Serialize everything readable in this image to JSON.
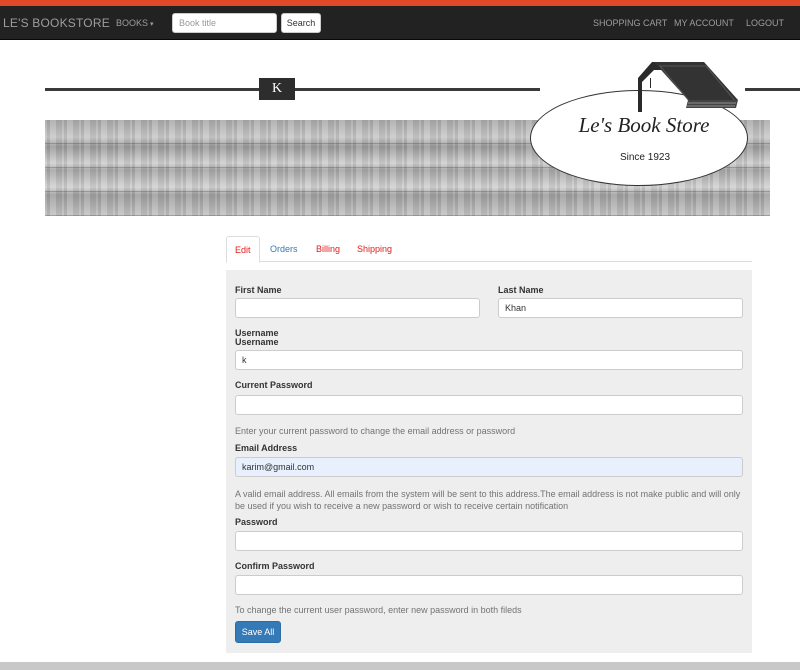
{
  "colors": {
    "top_strip": "#e0482a",
    "navbar_bg": "#222222",
    "tab_active": "#e31b1b",
    "tab_link_blue": "#337ab7",
    "tab_link_red": "#e31b1b",
    "primary_button": "#337ab7"
  },
  "navbar": {
    "brand": "LE'S BOOKSTORE",
    "books_label": "BOOKS",
    "books_caret_icon": "caret-down-icon",
    "search": {
      "placeholder": "Book title",
      "value": "",
      "button_label": "Search"
    },
    "right_links": [
      "SHOPPING CART",
      "MY ACCOUNT",
      "LOGOUT"
    ]
  },
  "header": {
    "user_initial": "K",
    "logo_title": "Le's Book Store",
    "logo_subtitle": "Since 1923",
    "logo_icon": "house-books-icon"
  },
  "tabs": [
    {
      "label": "Edit",
      "active": true
    },
    {
      "label": "Orders",
      "active": false
    },
    {
      "label": "Billing",
      "active": false
    },
    {
      "label": "Shipping",
      "active": false
    }
  ],
  "form": {
    "first_name": {
      "label": "First Name",
      "value": ""
    },
    "last_name": {
      "label": "Last Name",
      "value": "Khan"
    },
    "username": {
      "label_line1": "Username",
      "label_line2": "Username",
      "value": "k"
    },
    "current_password": {
      "label": "Current Password",
      "value": "",
      "help": "Enter your current password to change the email address or password"
    },
    "email": {
      "label": "Email Address",
      "value": "karim@gmail.com",
      "help": "A valid email address. All emails from the system will be sent to this address.The email address is not make public and will only be used if you wish to receive a new password or wish to receive certain notification"
    },
    "password": {
      "label": "Password",
      "value": ""
    },
    "confirm_password": {
      "label": "Confirm Password",
      "value": "",
      "help": "To change the current user password, enter new password in both fileds"
    },
    "save_label": "Save All"
  }
}
